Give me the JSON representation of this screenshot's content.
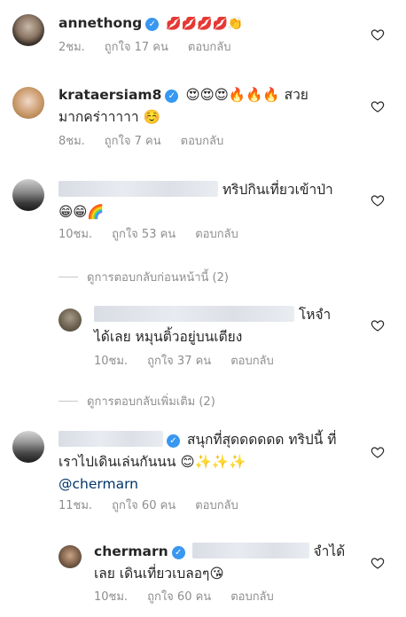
{
  "comments": [
    {
      "username": "annethong",
      "text": "💋💋💋💋👏",
      "time": "2ชม.",
      "likes": "ถูกใจ 17 คน",
      "reply": "ตอบกลับ"
    },
    {
      "username": "krataersiam8",
      "text_line1": "😍😍😍🔥🔥🔥 สวย",
      "text_line2": "มากคร่าาาาา ☺️",
      "time": "8ชม.",
      "likes": "ถูกใจ 7 คน",
      "reply": "ตอบกลับ"
    },
    {
      "text_line1": "ทริปกินเที่ยวเข้าป่า",
      "text_line2": "😁😁🌈",
      "time": "10ชม.",
      "likes": "ถูกใจ 53 คน",
      "reply": "ตอบกลับ"
    },
    {
      "text_line1": "โหจำ",
      "text_line2": "ได้เลย หมุนติ้วอยู่บนเตียง",
      "time": "10ชม.",
      "likes": "ถูกใจ 37 คน",
      "reply": "ตอบกลับ"
    },
    {
      "text_line1": "สนุกที่สุดดดดดด ทริปนี้ ที่",
      "text_line2": "เราไปเดินเล่นกันนน 😊✨✨✨",
      "mention": "@chermarn",
      "time": "11ชม.",
      "likes": "ถูกใจ 60 คน",
      "reply": "ตอบกลับ"
    },
    {
      "username": "chermarn",
      "text_line1": "จำได้",
      "text_line2": "เลย เดินเที่ยวเบลอๆ😘",
      "time": "10ชม.",
      "likes": "ถูกใจ 60 คน",
      "reply": "ตอบกลับ"
    }
  ],
  "view_previous_replies": "ดูการตอบกลับก่อนหน้านี้ (2)",
  "view_more_replies": "ดูการตอบกลับเพิ่มเติม (2)",
  "colors": {
    "verified": "#3897f0",
    "meta": "#8e8e8e",
    "text": "#262626",
    "mention": "#003569"
  }
}
